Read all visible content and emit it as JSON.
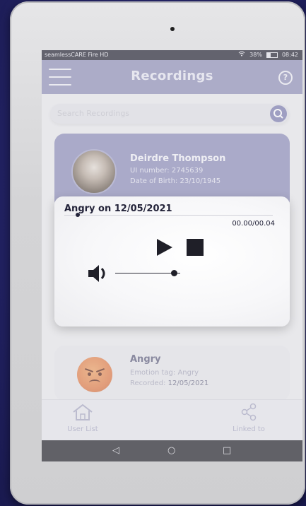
{
  "status_bar": {
    "device_label": "seamlessCARE Fire HD",
    "battery": "38%",
    "time": "08:42"
  },
  "header": {
    "title": "Recordings",
    "help_symbol": "?"
  },
  "search": {
    "placeholder": "Search Recordings"
  },
  "profile": {
    "name": "Deirdre Thompson",
    "ui_number": "UI number: 2745639",
    "dob": "Date of Birth: 23/10/1945"
  },
  "player": {
    "title": "Angry on 12/05/2021",
    "time": "00.00/00.04",
    "progress": 0.0,
    "volume": 0.9
  },
  "recording_card": {
    "title": "Angry",
    "emotion_tag": "Emotion tag: Angry",
    "recorded_label": "Recorded:",
    "recorded_date": "12/05/2021"
  },
  "bottom_nav": {
    "user_list": "User List",
    "linked_to": "Linked to"
  },
  "colors": {
    "header": "#8f8fb9",
    "accent": "#7c7cb0"
  }
}
